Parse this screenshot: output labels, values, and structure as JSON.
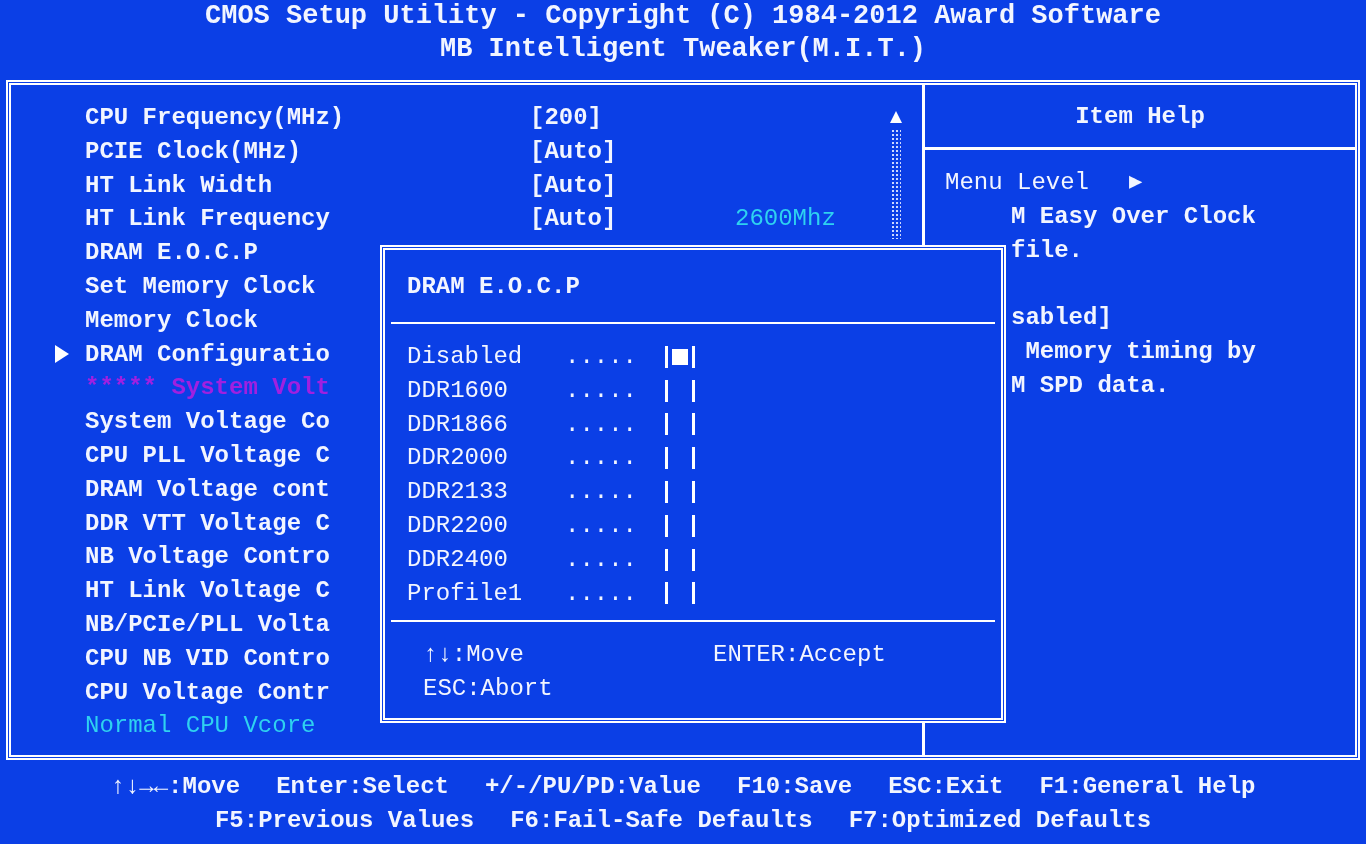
{
  "header": {
    "title": "CMOS Setup Utility - Copyright (C) 1984-2012 Award Software",
    "subtitle": "MB Intelligent Tweaker(M.I.T.)"
  },
  "settings": [
    {
      "kind": "setting",
      "label": "CPU Frequency(MHz)",
      "value": "[200]"
    },
    {
      "kind": "setting",
      "label": "PCIE Clock(MHz)",
      "value": "[Auto]"
    },
    {
      "kind": "setting",
      "label": "HT Link Width",
      "value": "[Auto]"
    },
    {
      "kind": "setting",
      "label": "HT Link Frequency",
      "value": "[Auto]",
      "extra": "2600Mhz"
    },
    {
      "kind": "setting",
      "label": "DRAM E.O.C.P"
    },
    {
      "kind": "setting",
      "label": "Set Memory Clock"
    },
    {
      "kind": "setting",
      "label": "Memory Clock"
    },
    {
      "kind": "submenu",
      "label": "DRAM Configuratio"
    },
    {
      "kind": "heading",
      "label": "***** System Volt"
    },
    {
      "kind": "setting",
      "label": "System Voltage Co"
    },
    {
      "kind": "setting",
      "label": "CPU PLL Voltage C"
    },
    {
      "kind": "setting",
      "label": "DRAM Voltage cont"
    },
    {
      "kind": "setting",
      "label": "DDR VTT Voltage C"
    },
    {
      "kind": "setting",
      "label": "NB Voltage Contro"
    },
    {
      "kind": "setting",
      "label": "HT Link Voltage C"
    },
    {
      "kind": "setting",
      "label": "NB/PCIe/PLL Volta"
    },
    {
      "kind": "setting",
      "label": "CPU NB VID Contro"
    },
    {
      "kind": "setting",
      "label": "CPU Voltage Contr"
    },
    {
      "kind": "info",
      "label": "Normal CPU Vcore"
    }
  ],
  "item_help": {
    "title": "Item Help",
    "menu_level": "Menu Level",
    "menu_level_marker": "▶",
    "paragraphs": [
      [
        "M Easy Over Clock",
        "file."
      ],
      [
        "sabled]",
        " Memory timing by",
        "M SPD data."
      ]
    ]
  },
  "popup": {
    "title": "DRAM E.O.C.P",
    "options": [
      {
        "label": "Disabled",
        "leader": ".....",
        "selected": true
      },
      {
        "label": "DDR1600",
        "leader": ".....",
        "selected": false
      },
      {
        "label": "DDR1866",
        "leader": ".....",
        "selected": false
      },
      {
        "label": "DDR2000",
        "leader": ".....",
        "selected": false
      },
      {
        "label": "DDR2133",
        "leader": ".....",
        "selected": false
      },
      {
        "label": "DDR2200",
        "leader": ".....",
        "selected": false
      },
      {
        "label": "DDR2400",
        "leader": ".....",
        "selected": false
      },
      {
        "label": "Profile1",
        "leader": ".....",
        "selected": false
      }
    ],
    "hints": [
      "↑↓:Move",
      "ENTER:Accept",
      "ESC:Abort"
    ]
  },
  "footer": [
    [
      "↑↓→←:Move",
      "Enter:Select",
      "+/-/PU/PD:Value",
      "F10:Save",
      "ESC:Exit",
      "F1:General Help"
    ],
    [
      "F5:Previous Values",
      "F6:Fail-Safe Defaults",
      "F7:Optimized Defaults"
    ]
  ]
}
